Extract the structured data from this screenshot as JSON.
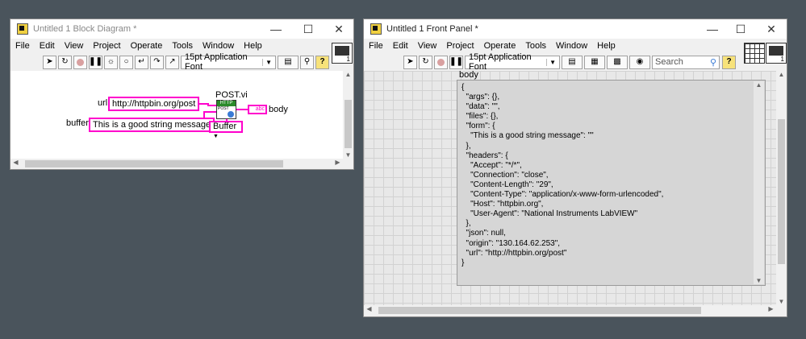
{
  "block_diagram": {
    "title": "Untitled 1 Block Diagram *",
    "menu": [
      "File",
      "Edit",
      "View",
      "Project",
      "Operate",
      "Tools",
      "Window",
      "Help"
    ],
    "font_selector": "15pt Application Font",
    "url_label": "url",
    "url_value": "http://httpbin.org/post",
    "buffer_label": "buffer",
    "buffer_value": "This is a good string message",
    "vi_label": "POST.vi",
    "http_badge": "HTTP",
    "post_badge": "POST",
    "body_indicator_glyph": "abc",
    "body_label": "body",
    "buffer_ring": "Buffer"
  },
  "front_panel": {
    "title": "Untitled 1 Front Panel *",
    "menu": [
      "File",
      "Edit",
      "View",
      "Project",
      "Operate",
      "Tools",
      "Window",
      "Help"
    ],
    "font_selector": "15pt Application Font",
    "search_placeholder": "Search",
    "body_label": "body",
    "body_text": "{\n  \"args\": {},\n  \"data\": \"\",\n  \"files\": {},\n  \"form\": {\n    \"This is a good string message\": \"\"\n  },\n  \"headers\": {\n    \"Accept\": \"*/*\",\n    \"Connection\": \"close\",\n    \"Content-Length\": \"29\",\n    \"Content-Type\": \"application/x-www-form-urlencoded\",\n    \"Host\": \"httpbin.org\",\n    \"User-Agent\": \"National Instruments LabVIEW\"\n  },\n  \"json\": null,\n  \"origin\": \"130.164.62.253\",\n  \"url\": \"http://httpbin.org/post\"\n}"
  },
  "icons": {
    "run": "run-arrow-icon",
    "run_continuous": "run-continuously-icon",
    "abort": "abort-icon",
    "pause": "pause-icon",
    "highlight": "highlight-execution-icon",
    "retain": "retain-wire-values-icon",
    "step_into": "step-into-icon",
    "step_over": "step-over-icon",
    "step_out": "step-out-icon",
    "align": "align-objects-icon",
    "distribute": "distribute-objects-icon",
    "resize": "resize-objects-icon",
    "reorder": "reorder-icon",
    "cleanup": "clean-up-diagram-icon",
    "help": "context-help-icon",
    "search": "search-icon"
  },
  "colors": {
    "string_wire": "#ff00cc",
    "desktop": "#4a545c",
    "panel_grid": "#e8e8e8"
  }
}
